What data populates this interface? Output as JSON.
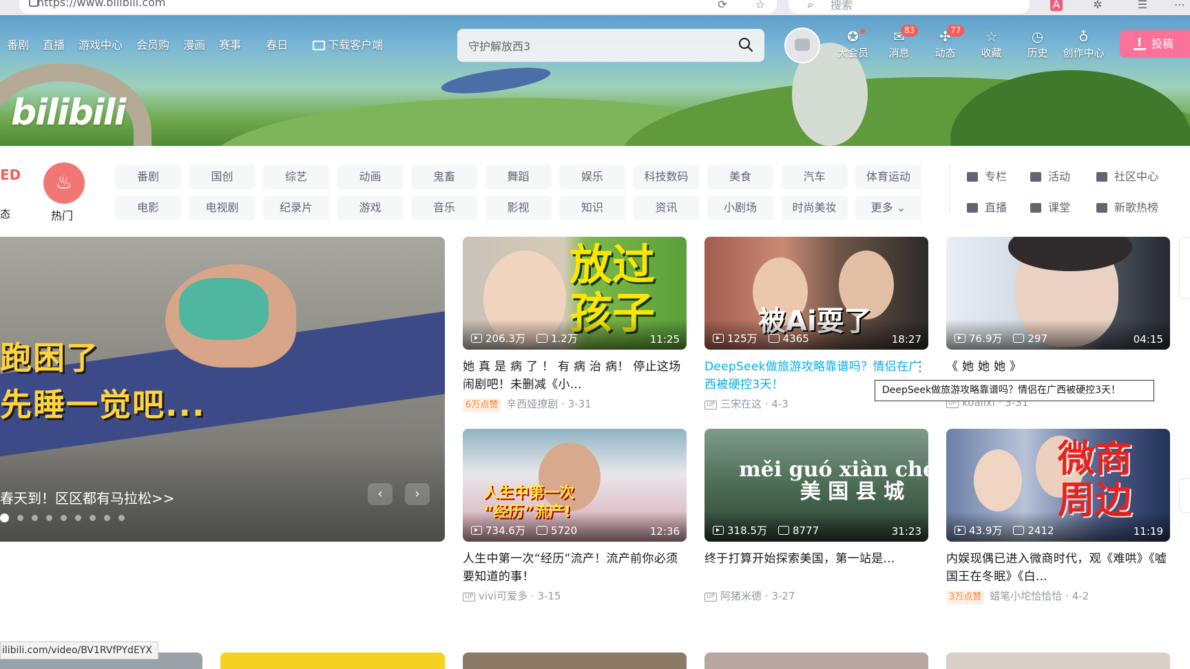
{
  "browser": {
    "url": "https://www.bilibili.com",
    "search_placeholder": "搜索"
  },
  "header": {
    "logo": "bilibili",
    "nav": [
      "番剧",
      "直播",
      "游戏中心",
      "会员购",
      "漫画",
      "赛事",
      "春日",
      "下载客户端"
    ],
    "search_value": "守护解放西3",
    "right_nav": [
      {
        "label": "大会员",
        "icon": "vip-icon",
        "badge": ""
      },
      {
        "label": "消息",
        "icon": "message-icon",
        "badge": "83"
      },
      {
        "label": "动态",
        "icon": "dynamic-icon",
        "badge": "77"
      },
      {
        "label": "收藏",
        "icon": "star-icon",
        "badge": ""
      },
      {
        "label": "历史",
        "icon": "clock-icon",
        "badge": ""
      },
      {
        "label": "创作中心",
        "icon": "bulb-icon",
        "badge": ""
      }
    ],
    "upload": "投稿"
  },
  "channels": {
    "dynamic_label": "态",
    "dynamic_badge": "ED",
    "hot": "热门",
    "categories": [
      "番剧",
      "国创",
      "综艺",
      "动画",
      "鬼畜",
      "舞蹈",
      "娱乐",
      "科技数码",
      "美食",
      "汽车",
      "体育运动",
      "电影",
      "电视剧",
      "纪录片",
      "游戏",
      "音乐",
      "影视",
      "知识",
      "资讯",
      "小剧场",
      "时尚美妆",
      "更多"
    ],
    "side_links": [
      "专栏",
      "活动",
      "社区中心",
      "直播",
      "课堂",
      "新歌热榜"
    ]
  },
  "hero": {
    "caption_line1": "跑困了",
    "caption_line2": "先睡一觉吧...",
    "title": "春天到！区区都有马拉松>>",
    "dots": 9,
    "active_dot": 0,
    "prev": "‹",
    "next": "›"
  },
  "videos": [
    {
      "views": "206.3万",
      "danmaku": "1.2万",
      "duration": "11:25",
      "thumb_text": "放过\n孩子",
      "title": "她 真 是 病 了 ！ 有 病 治 病！ 停止这场闹剧吧！未删减《小...",
      "likes": "6万点赞",
      "author": "辛西娅撩剧",
      "date": "3-31",
      "up": false
    },
    {
      "views": "125万",
      "danmaku": "4365",
      "duration": "18:27",
      "thumb_text": "被Ai耍了",
      "title": "DeepSeek做旅游攻略靠谱吗？情侣在广西被硬控3天！",
      "likes": "",
      "author": "三宋在这",
      "date": "4-3",
      "up": true
    },
    {
      "views": "76.9万",
      "danmaku": "297",
      "duration": "04:15",
      "thumb_text": "",
      "title": "《 她 她 她 》",
      "likes": "",
      "author": "koalixi",
      "date": "3-31",
      "up": true
    },
    {
      "views": "734.6万",
      "danmaku": "5720",
      "duration": "12:36",
      "thumb_text": "人生中第一次\n“经历”流产!",
      "title": "人生中第一次“经历”流产！流产前你必须要知道的事！",
      "likes": "",
      "author": "vivi可爱多",
      "date": "3-15",
      "up": true
    },
    {
      "views": "318.5万",
      "danmaku": "8777",
      "duration": "31:23",
      "thumb_text": "měi guó xiàn chéng\n美 国 县 城",
      "title": "终于打算开始探索美国，第一站是...",
      "likes": "",
      "author": "阿猪米德",
      "date": "3-27",
      "up": true
    },
    {
      "views": "43.9万",
      "danmaku": "2412",
      "duration": "11:19",
      "thumb_text": "微商\n周边",
      "title": "内娱现偶已进入微商时代，观《难哄》《嘘国王在冬眠》《白...",
      "likes": "3万点赞",
      "author": "蜡笔小坨恰恰恰",
      "date": "4-2",
      "up": false
    }
  ],
  "tooltip": "DeepSeek做旅游攻略靠谱吗？情侣在广西被硬控3天！",
  "status_url": "ilibili.com/video/BV1RVfPYdEYX",
  "colors": {
    "brand_pink": "#fb7299",
    "accent_blue": "#00aeec",
    "badge_red": "#fa5a57"
  }
}
